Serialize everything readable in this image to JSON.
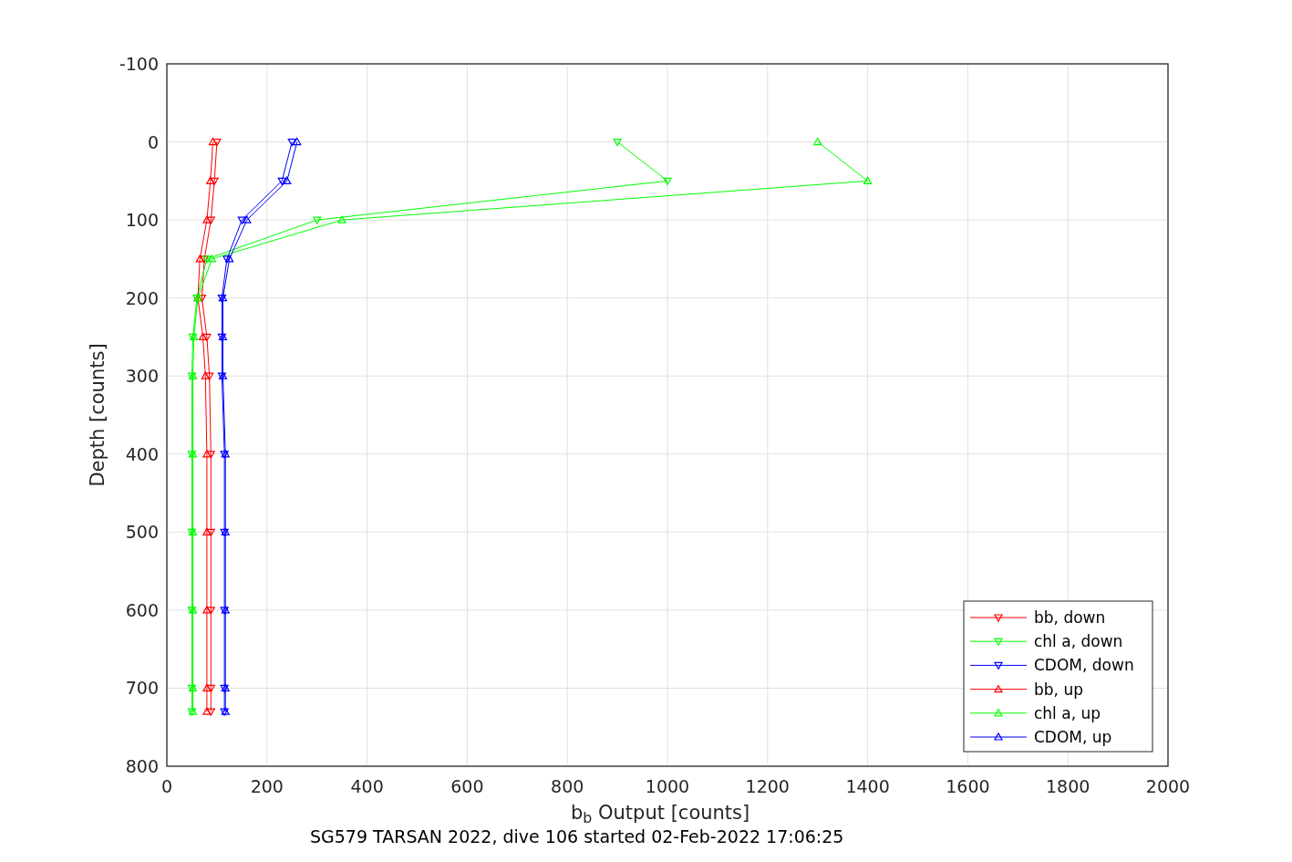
{
  "figure": {
    "caption": "SG579 TARSAN 2022, dive 106 started 02-Feb-2022 17:06:25",
    "chart_data": {
      "type": "line",
      "orientation": "horizontal",
      "xlabel": "b$_{b}$ Output [counts]",
      "ylabel": "Depth [counts]",
      "x": [
        0,
        50,
        100,
        150,
        200,
        250,
        300,
        400,
        500,
        600,
        700,
        730
      ],
      "xlim": [
        0,
        2000
      ],
      "ylim": [
        800,
        -100
      ],
      "grid": true,
      "legend": true,
      "xticks": [
        0,
        200,
        400,
        600,
        800,
        1000,
        1200,
        1400,
        1600,
        1800,
        2000
      ],
      "yticks": [
        -100,
        0,
        100,
        200,
        300,
        400,
        500,
        600,
        700,
        800
      ],
      "series": [
        {
          "name": "bb, down",
          "color": "#ff0000",
          "marker": "triangle",
          "values": [
            100,
            95,
            88,
            75,
            70,
            80,
            85,
            88,
            88,
            88,
            88,
            88
          ]
        },
        {
          "name": "chl a, down",
          "color": "#00ff00",
          "marker": "triangle",
          "values": [
            900,
            1000,
            300,
            80,
            60,
            52,
            50,
            50,
            50,
            50,
            50,
            50
          ]
        },
        {
          "name": "CDOM, down",
          "color": "#0000ff",
          "marker": "triangle",
          "values": [
            250,
            230,
            150,
            120,
            110,
            110,
            110,
            115,
            115,
            115,
            115,
            115
          ]
        },
        {
          "name": "bb, up",
          "color": "#ff0000",
          "marker": "triangle",
          "values": [
            92,
            87,
            80,
            66,
            62,
            72,
            77,
            80,
            80,
            80,
            80,
            80
          ]
        },
        {
          "name": "chl a, up",
          "color": "#00ff00",
          "marker": "triangle",
          "values": [
            1300,
            1400,
            350,
            90,
            62,
            54,
            52,
            52,
            52,
            52,
            52,
            52
          ]
        },
        {
          "name": "CDOM, up",
          "color": "#0000ff",
          "marker": "triangle",
          "values": [
            260,
            240,
            160,
            125,
            112,
            112,
            112,
            117,
            117,
            117,
            117,
            117
          ]
        }
      ]
    }
  }
}
